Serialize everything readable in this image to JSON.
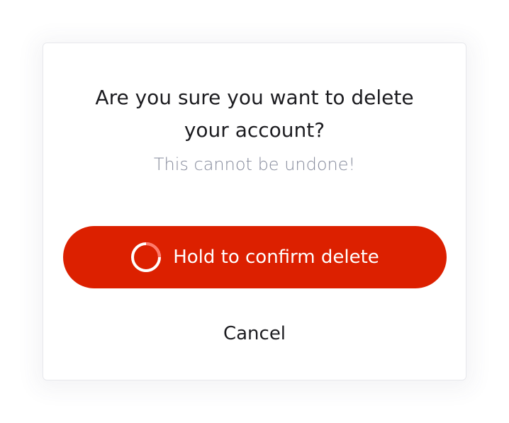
{
  "dialog": {
    "title": "Are you sure you want to delete your account?",
    "subtitle": "This cannot be undone!",
    "hold_button_label": "Hold to confirm delete",
    "hold_progress": 0.25,
    "cancel_label": "Cancel"
  },
  "colors": {
    "danger": "#dc2000",
    "progress_track": "#ffffff",
    "progress_fill": "#ff7a6a",
    "subtitle": "#868b9c",
    "text": "#1c1c20"
  },
  "icons": {
    "progress": "progress-ring-icon"
  }
}
